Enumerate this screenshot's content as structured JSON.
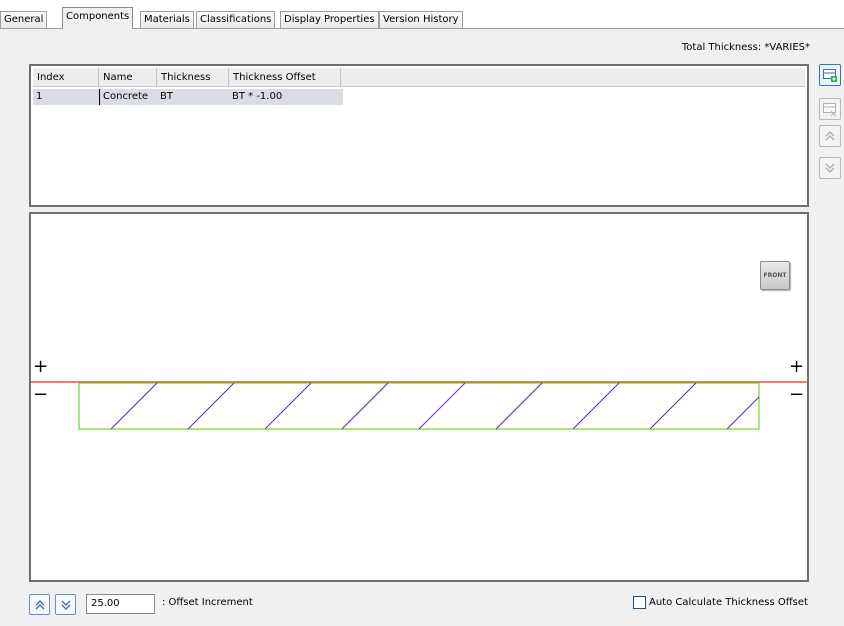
{
  "tabs": [
    {
      "label": "General"
    },
    {
      "label": "Components"
    },
    {
      "label": "Materials"
    },
    {
      "label": "Classifications"
    },
    {
      "label": "Display Properties"
    },
    {
      "label": "Version History"
    }
  ],
  "active_tab": "Components",
  "total_thickness": "Total Thickness: *VARIES*",
  "table": {
    "columns": [
      "Index",
      "Name",
      "Thickness",
      "Thickness Offset"
    ],
    "rows": [
      {
        "index": "1",
        "name": "Concrete",
        "thickness": "BT",
        "offset": "BT * -1.00"
      }
    ]
  },
  "side_buttons": [
    {
      "icon": "add-component-icon",
      "enabled": true
    },
    {
      "icon": "remove-component-icon",
      "enabled": false
    },
    {
      "icon": "move-up-icon",
      "enabled": false
    },
    {
      "icon": "move-down-icon",
      "enabled": false
    }
  ],
  "preview": {
    "front_label": "FRONT",
    "plus_symbol": "+",
    "minus_symbol": "−",
    "colors": {
      "baseline": "#ff2020",
      "outline": "#66dd22",
      "hatch": "#5a2ab5"
    }
  },
  "offset_increment": {
    "value": "25.00",
    "label": ": Offset Increment"
  },
  "auto_calculate": {
    "label": "Auto Calculate Thickness Offset",
    "checked": false
  }
}
